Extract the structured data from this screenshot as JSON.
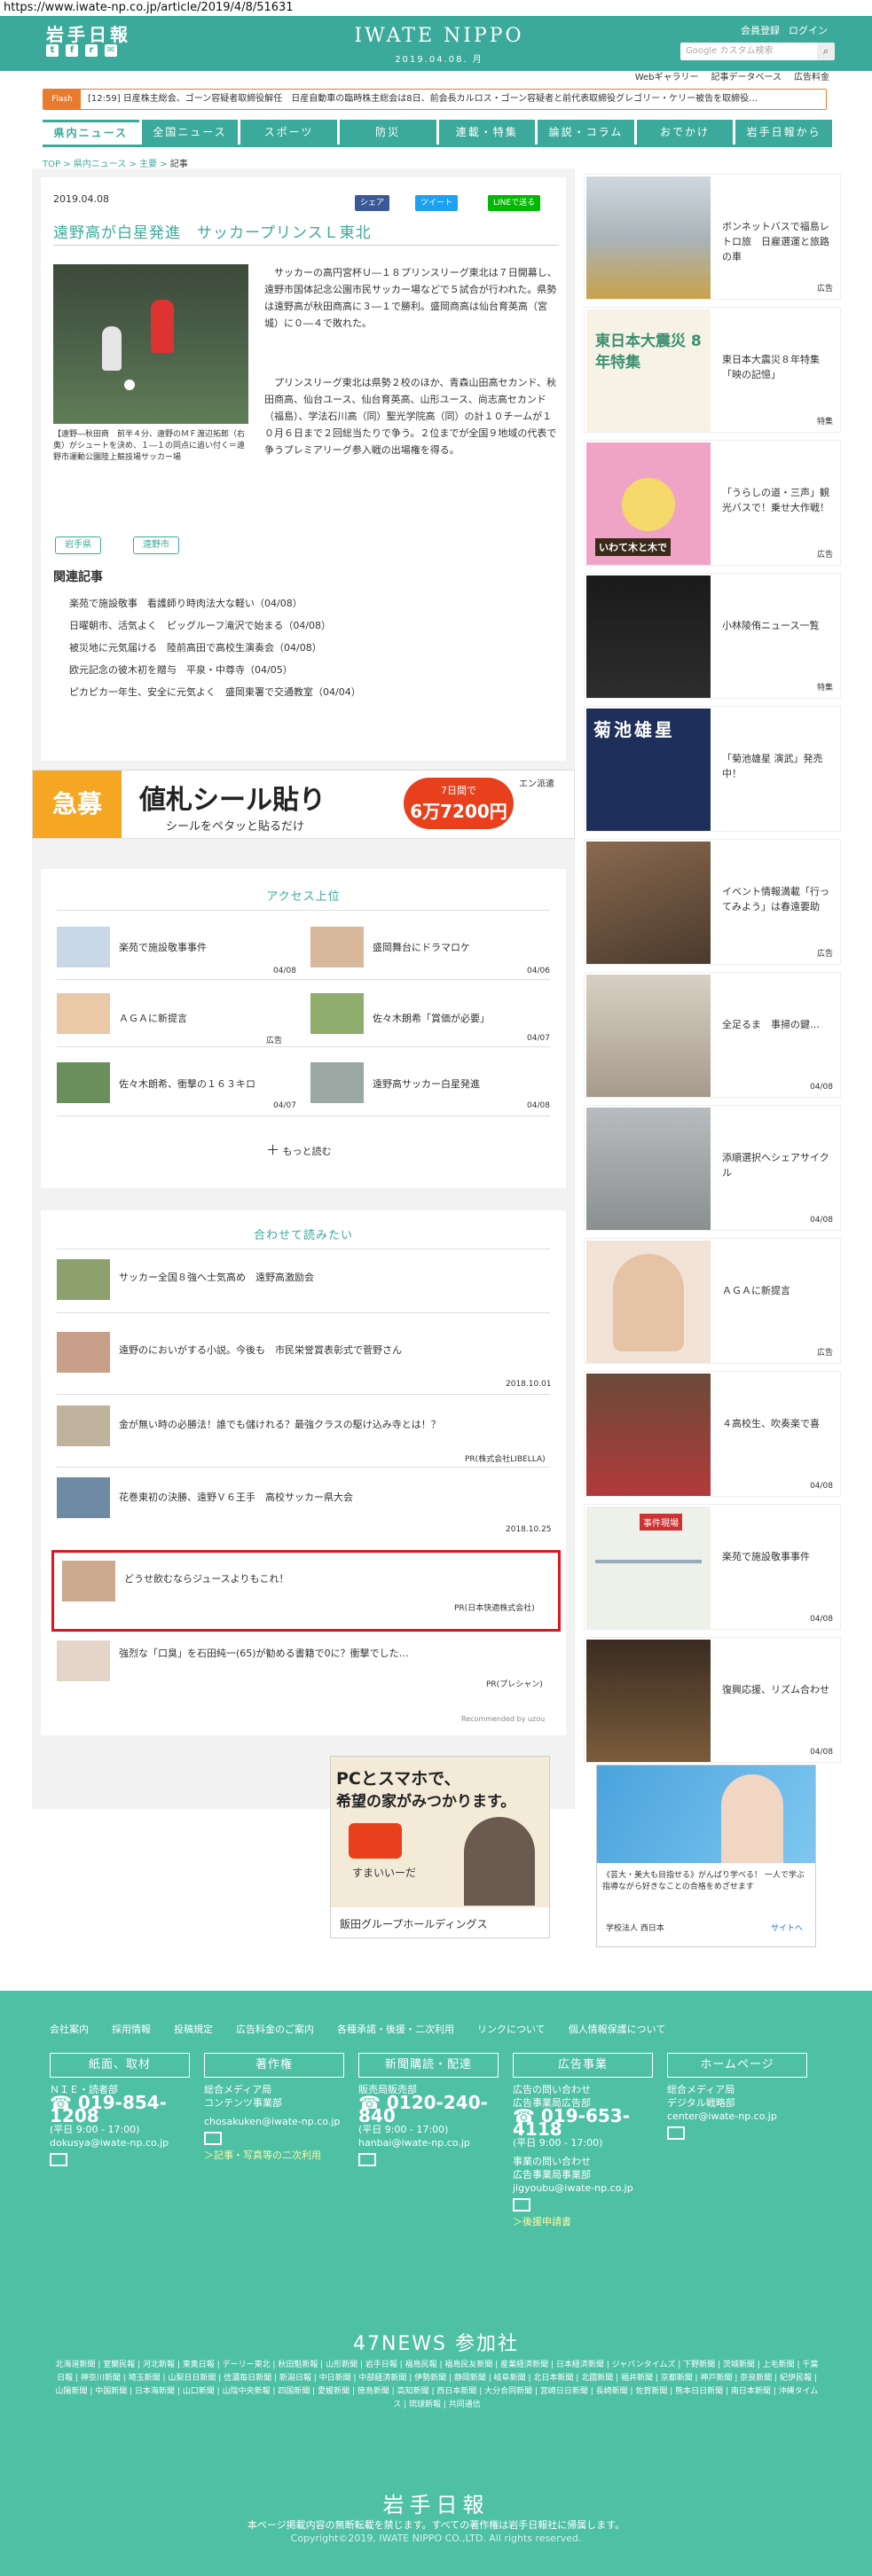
{
  "url": "https://www.iwate-np.co.jp/article/2019/4/8/51631",
  "header": {
    "logo_jp": "岩手日報",
    "brand": "IWATE NIPPO",
    "date": "2019.04.08. 月",
    "member_register": "会員登録",
    "login": "ログイン",
    "search_placeholder": "Google カスタム検索",
    "sub_links": [
      "Webギャラリー",
      "記事データベース",
      "広告料金"
    ]
  },
  "flash": {
    "tag": "Flash",
    "text": "[12:59] 日産株主総会、ゴーン容疑者取締役解任　日産自動車の臨時株主総会は8日、前会長カルロス・ゴーン容疑者と前代表取締役グレゴリー・ケリー被告を取締役…"
  },
  "nav": [
    "県内ニュース",
    "全国ニュース",
    "スポーツ",
    "防災",
    "連載・特集",
    "論説・コラム",
    "おでかけ",
    "岩手日報から"
  ],
  "breadcrumb": [
    "TOP",
    "県内ニュース",
    "主要",
    "記事"
  ],
  "article": {
    "date": "2019.04.08",
    "share_labels": [
      "シェア",
      "ツイート",
      "LINEで送る"
    ],
    "title": "遠野高が白星発進　サッカープリンスＬ東北",
    "caption": "【遠野―秋田商　前半４分、遠野のＭＦ渡辺拓郎（右奥）がシュートを決め、１―１の同点に追い付く＝遠野市運動公園陸上競技場サッカー場",
    "body_p1": "　サッカーの高円宮杯Ｕ―１８プリンスリーグ東北は７日開幕し、遠野市国体記念公園市民サッカー場などで５試合が行われた。県勢は遠野高が秋田商高に３―１で勝利。盛岡商高は仙台育英高（宮城）に０―４で敗れた。",
    "body_p2": "　プリンスリーグ東北は県勢２校のほか、青森山田高セカンド、秋田商高、仙台ユース、仙台育英高、山形ユース、尚志高セカンド（福島）、学法石川高（同）聖光学院高（同）の計１０チームが１０月６日まで２回総当たりで争う。２位までが全国９地域の代表で争うプレミアリーグ参入戦の出場権を得る。",
    "tags": [
      "岩手県",
      "遠野市"
    ],
    "related_title": "関連記事",
    "related": [
      "楽苑で施設敬事　看護師り時肉法大な軽い（04/08）",
      "日曜朝市、活気よく　ピッグルーフ滝沢で始まる（04/08）",
      "被災地に元気届ける　陸前高田で高校生演奏会（04/08）",
      "欧元記念の彼木初を贈与　平泉・中尊寺（04/05）",
      "ピカピカ一年生、安全に元気よく　盛岡東署で交通教室（04/04）"
    ]
  },
  "ad_banner": {
    "kyubo": "急募",
    "title": "値札シール貼り",
    "sub": "シールをペタッと貼るだけ",
    "pill_top": "7日間で",
    "pill_amount": "6万7200円",
    "brand": "エン派遣"
  },
  "access": {
    "title": "アクセス上位",
    "items": [
      {
        "text": "楽苑で施設敬事事件",
        "date": "04/08"
      },
      {
        "text": "盛岡舞台にドラマロケ",
        "date": "04/06"
      },
      {
        "text": "ＡＧＡに新提言",
        "date": "広告"
      },
      {
        "text": "佐々木朗希「賞価が必要」",
        "date": "04/07"
      },
      {
        "text": "佐々木朗希、衝撃の１６３キロ",
        "date": "04/07"
      },
      {
        "text": "遠野高サッカー白星発進",
        "date": "04/08"
      }
    ],
    "more": "もっと読む"
  },
  "recommend": {
    "title": "合わせて読みたい",
    "items": [
      {
        "text": "サッカー全国８強へ士気高め　遠野高激励会",
        "meta": ""
      },
      {
        "text": "遠野のにおいがする小説。今後も　市民栄誉賞表彰式で菅野さん",
        "meta": "2018.10.01"
      },
      {
        "text": "金が無い時の必勝法！誰でも儲けれる？最強クラスの駆け込み寺とは！？",
        "meta": "PR(株式会社LIBELLA)"
      },
      {
        "text": "花巻東初の決勝、遠野Ｖ６王手　高校サッカー県大会",
        "meta": "2018.10.25"
      },
      {
        "text": "どうせ飲むならジュースよりもこれ！",
        "meta": "PR(日本快適株式会社)"
      },
      {
        "text": "強烈な「口臭」を石田純一(65)が勧める書籍で0に？衝撃でした…",
        "meta": "PR(プレシャン)"
      }
    ],
    "powered": "Recommended by uzou"
  },
  "mid_ads": {
    "left_line1": "PCとスマホで、",
    "left_line2": "希望の家がみつかります。",
    "left_sumai": "すまいいーだ",
    "left_group": "飯田グループホールディングス",
    "right_text": "《芸大・美大も目指せる》がんばり学べる！ 一人で学ぶ指導ながら好きなことの合格をめざせます",
    "right_school": "学校法人 西日本",
    "right_site": "サイトへ"
  },
  "sidebar": [
    {
      "text": "ボンネットバスで福島レトロ旅　日雇選運と旅路の車",
      "meta": "広告"
    },
    {
      "text": "東日本大震災８年特集「映の記憶」",
      "meta": "特集",
      "img_text": "東日本大震災 8年特集"
    },
    {
      "text": "「うらしの道・三声」観光バスで！乗せ大作戦！",
      "meta": "広告",
      "img_text": "いわて木と木で"
    },
    {
      "text": "小林陵侑ニュース一覧",
      "meta": "特集"
    },
    {
      "text": "「菊池雄星 演武」発売中！",
      "meta": "",
      "img_text": "菊池雄星"
    },
    {
      "text": "イベント情報満載「行ってみよう」は春遠要助",
      "meta": "広告"
    },
    {
      "text": "全足るま　事掃の鍵…",
      "meta": "04/08"
    },
    {
      "text": "添順選択へシェアサイクル",
      "meta": "04/08"
    },
    {
      "text": "ＡＧＡに新提言",
      "meta": "広告"
    },
    {
      "text": "４高校生、吹奏楽で喜",
      "meta": "04/08"
    },
    {
      "text": "楽苑で施設敬事事件",
      "meta": "04/08",
      "img_text": "事件現場"
    },
    {
      "text": "復興応援、リズム合わせ",
      "meta": "04/08"
    }
  ],
  "footer": {
    "links": [
      "会社案内",
      "採用情報",
      "投稿規定",
      "広告料金のご案内",
      "各種承諾・後援・二次利用",
      "リンクについて",
      "個人情報保護について"
    ],
    "boxes": [
      "紙面、取材",
      "著作権",
      "新聞購読・配達",
      "広告事業",
      "ホームページ"
    ],
    "col1_label": "ＮＩＥ・読者部",
    "col1_phone": "019-854-1208",
    "col1_hours": "(平日 9:00 - 17:00)",
    "col1_email": "dokusya@iwate-np.co.jp",
    "col2_label1": "総合メディア局",
    "col2_label2": "コンテンツ事業部",
    "col2_email": "chosakuken@iwate-np.co.jp",
    "col2_link": "＞記事・写真等の二次利用",
    "col3_label": "販売局販売部",
    "col3_phone": "0120-240-840",
    "col3_hours": "(平日 9:00 - 17:00)",
    "col3_email": "hanbai@iwate-np.co.jp",
    "col4_label1": "広告の問い合わせ",
    "col4_label2": "広告事業局広告部",
    "col4_phone": "019-653-4118",
    "col4_hours": "(平日 9:00 - 17:00)",
    "col4_label3": "事業の問い合わせ",
    "col4_label4": "広告事業局事業部",
    "col4_email": "jigyoubu@iwate-np.co.jp",
    "col4_link": "＞後援申請書",
    "col5_label1": "総合メディア局",
    "col5_label2": "デジタル戦略部",
    "col5_email": "center@iwate-np.co.jp",
    "n47_title": "47NEWS 参加社",
    "n47_links": "北海道新聞 | 室蘭民報 | 河北新報 | 東奥日報 | デーリー東北 | 秋田魁新報 | 山形新聞 | 岩手日報 | 福島民報 | 福島民友新聞 | 産業経済新聞 | 日本経済新聞 | ジャパンタイムズ | 下野新聞 | 茨城新聞 | 上毛新聞 | 千葉日報 | 神奈川新聞 | 埼玉新聞 | 山梨日日新聞 | 信濃毎日新聞 | 新潟日報 | 中日新聞 | 中部経済新聞 | 伊勢新聞 | 静岡新聞 | 岐阜新聞 | 北日本新聞 | 北國新聞 | 福井新聞 | 京都新聞 | 神戸新聞 | 奈良新聞 | 紀伊民報 | 山陽新聞 | 中国新聞 | 日本海新聞 | 山口新聞 | 山陰中央新報 | 四国新聞 | 愛媛新聞 | 徳島新聞 | 高知新聞 | 西日本新聞 | 大分合同新聞 | 宮崎日日新聞 | 長崎新聞 | 佐賀新聞 | 熊本日日新聞 | 南日本新聞 | 沖縄タイムス | 琉球新報 | 共同通信",
    "logo": "岩手日報",
    "note": "本ページ掲載内容の無断転載を禁じます。すべての著作権は岩手日報社に帰属します。",
    "copyright": "Copyright©2019, IWATE NIPPO CO.,LTD. All rights reserved."
  },
  "colors": {
    "accent": "#3baa9a",
    "footer": "#4ec0a4",
    "flash": "#e97b2e",
    "highlight": "#e0141e"
  }
}
